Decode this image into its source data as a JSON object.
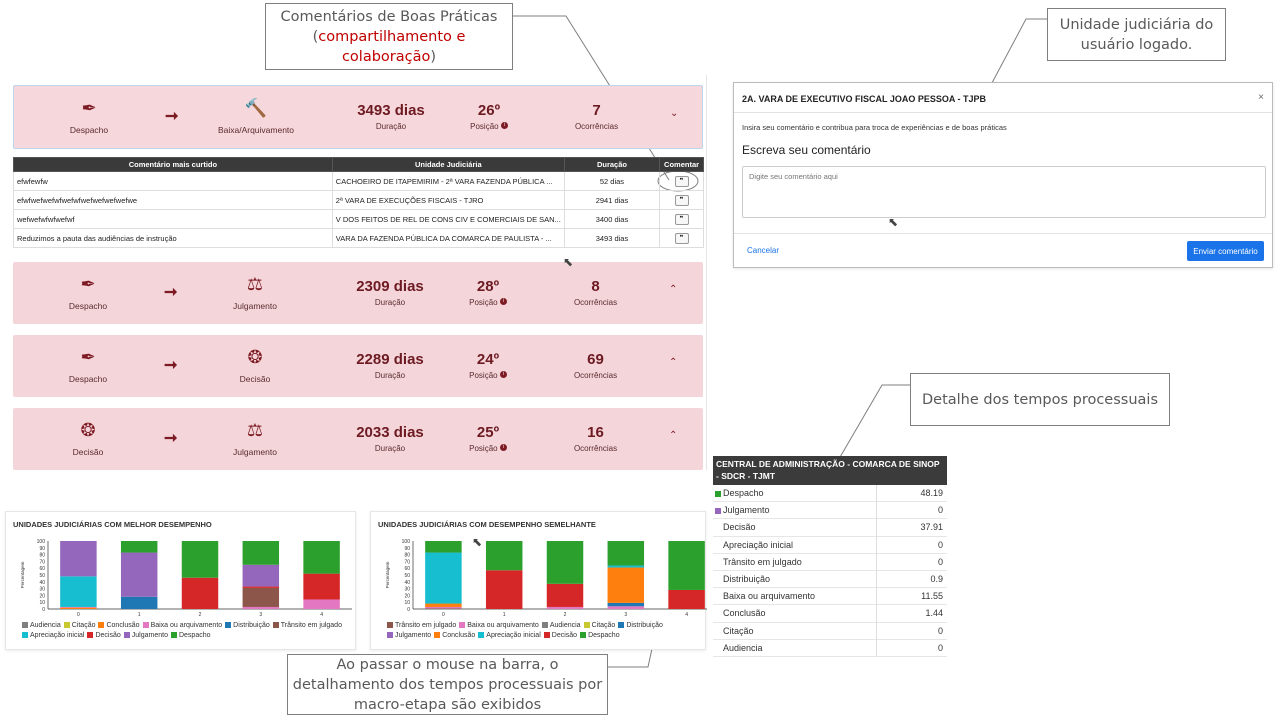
{
  "callouts": {
    "boas_praticas": {
      "line1": "Comentários de Boas Práticas",
      "line2_open": "(",
      "line2_red": "compartilhamento e",
      "line3_red": "colaboração",
      "line3_close": ")"
    },
    "unidade": {
      "line1": "Unidade judiciária do",
      "line2": "usuário logado."
    },
    "detalhe": {
      "text": "Detalhe dos tempos processuais"
    },
    "mouse": {
      "line1": "Ao passar o mouse na barra, o",
      "line2": "detalhamento dos tempos processuais por",
      "line3": "macro-etapa são exibidos"
    }
  },
  "flows": [
    {
      "from_icon": "gavel-pen-icon",
      "from": "Despacho",
      "to_icon": "hammer-icon",
      "to": "Baixa/Arquivamento",
      "duration": "3493 dias",
      "duration_label": "Duração",
      "position": "26º",
      "position_label": "Posição",
      "occurrences": "7",
      "occurrences_label": "Ocorrências",
      "chevron": "⌄"
    },
    {
      "from_icon": "pen-icon",
      "from": "Despacho",
      "to_icon": "scales-icon",
      "to": "Julgamento",
      "duration": "2309 dias",
      "duration_label": "Duração",
      "position": "28º",
      "position_label": "Posição",
      "occurrences": "8",
      "occurrences_label": "Ocorrências",
      "chevron": "⌃"
    },
    {
      "from_icon": "pen-icon",
      "from": "Despacho",
      "to_icon": "brain-icon",
      "to": "Decisão",
      "duration": "2289 dias",
      "duration_label": "Duração",
      "position": "24º",
      "position_label": "Posição",
      "occurrences": "69",
      "occurrences_label": "Ocorrências",
      "chevron": "⌃"
    },
    {
      "from_icon": "brain-icon",
      "from": "Decisão",
      "to_icon": "scales-icon",
      "to": "Julgamento",
      "duration": "2033 dias",
      "duration_label": "Duração",
      "position": "25º",
      "position_label": "Posição",
      "occurrences": "16",
      "occurrences_label": "Ocorrências",
      "chevron": "⌃"
    }
  ],
  "comments_table": {
    "headers": [
      "Comentário mais curtido",
      "Unidade Judiciária",
      "Duração",
      "Comentar"
    ],
    "rows": [
      [
        "efwfewfw",
        "CACHOEIRO DE ITAPEMIRIM - 2ª VARA FAZENDA PÚBLICA ...",
        "52 dias"
      ],
      [
        "efwfwefwefwfwefwfwefwefwefwefwe",
        "2ª VARA DE EXECUÇÕES FISCAIS - TJRO",
        "2941 dias"
      ],
      [
        "wefwefwfwfwefwf",
        "V DOS FEITOS DE REL DE CONS CIV E COMERCIAIS DE SAN...",
        "3400 dias"
      ],
      [
        "Reduzimos a pauta das audiências de instrução",
        "VARA DA FAZENDA PÚBLICA DA COMARCA DE PAULISTA - ...",
        "3493 dias"
      ]
    ]
  },
  "modal": {
    "title": "2A. VARA DE EXECUTIVO FISCAL JOAO PESSOA - TJPB",
    "close": "×",
    "hint": "Insira seu comentário e contribua para troca de experiências e de boas práticas",
    "heading": "Escreva seu comentário",
    "placeholder": "Digite seu comentário aqui",
    "cancel": "Cancelar",
    "send": "Enviar comentário"
  },
  "colors": {
    "Audiencia": "#7f7f7f",
    "Citação": "#c8c832",
    "Conclusão": "#ff7f0e",
    "Baixa ou arquivamento": "#e377c2",
    "Distribuição": "#1f77b4",
    "Trânsito em julgado": "#8c564b",
    "Apreciação inicial": "#17becf",
    "Decisão": "#d62728",
    "Julgamento": "#9467bd",
    "Despacho": "#2ca02c"
  },
  "chart_data": [
    {
      "type": "bar",
      "stacked": true,
      "title": "UNIDADES JUDICIÁRIAS COM MELHOR DESEMPENHO",
      "ylabel": "Percentagem",
      "ylim": [
        0,
        100
      ],
      "yticks": [
        0,
        10,
        20,
        30,
        40,
        50,
        60,
        70,
        80,
        90,
        100
      ],
      "categories": [
        "0",
        "1",
        "2",
        "3",
        "4"
      ],
      "series": [
        {
          "name": "Audiencia",
          "values": [
            0,
            0,
            0,
            0,
            0
          ]
        },
        {
          "name": "Citação",
          "values": [
            0,
            0,
            0,
            0,
            0
          ]
        },
        {
          "name": "Conclusão",
          "values": [
            2,
            0,
            0,
            0,
            0
          ]
        },
        {
          "name": "Baixa ou arquivamento",
          "values": [
            1,
            0,
            0,
            3,
            14
          ]
        },
        {
          "name": "Distribuição",
          "values": [
            0,
            18,
            0,
            0,
            0
          ]
        },
        {
          "name": "Trânsito em julgado",
          "values": [
            0,
            0,
            0,
            28,
            0
          ]
        },
        {
          "name": "Apreciação inicial",
          "values": [
            45,
            0,
            0,
            0,
            0
          ]
        },
        {
          "name": "Decisão",
          "values": [
            0,
            0,
            46,
            2,
            38
          ]
        },
        {
          "name": "Julgamento",
          "values": [
            52,
            65,
            0,
            32,
            0
          ]
        },
        {
          "name": "Despacho",
          "values": [
            0,
            17,
            54,
            35,
            48
          ]
        }
      ],
      "legend": [
        "Audiencia",
        "Citação",
        "Conclusão",
        "Baixa ou arquivamento",
        "Distribuição",
        "Trânsito em julgado",
        "Apreciação inicial",
        "Decisão",
        "Julgamento",
        "Despacho"
      ]
    },
    {
      "type": "bar",
      "stacked": true,
      "title": "UNIDADES JUDICIÁRIAS COM DESEMPENHO SEMELHANTE",
      "ylabel": "Percentagem",
      "ylim": [
        0,
        100
      ],
      "yticks": [
        0,
        10,
        20,
        30,
        40,
        50,
        60,
        70,
        80,
        90,
        100
      ],
      "categories": [
        "0",
        "1",
        "2",
        "3",
        "4"
      ],
      "series": [
        {
          "name": "Trânsito em julgado",
          "values": [
            1,
            0,
            0,
            0,
            0
          ]
        },
        {
          "name": "Baixa ou arquivamento",
          "values": [
            2,
            0,
            3,
            4,
            0
          ]
        },
        {
          "name": "Audiencia",
          "values": [
            0,
            0,
            0,
            0,
            0
          ]
        },
        {
          "name": "Citação",
          "values": [
            0,
            0,
            0,
            0,
            0
          ]
        },
        {
          "name": "Distribuição",
          "values": [
            0,
            0,
            0,
            5,
            0
          ]
        },
        {
          "name": "Conclusão",
          "values": [
            5,
            0,
            0,
            52,
            0
          ]
        },
        {
          "name": "Apreciação inicial",
          "values": [
            75,
            0,
            0,
            3,
            0
          ]
        },
        {
          "name": "Decisão",
          "values": [
            0,
            57,
            34,
            0,
            28
          ]
        },
        {
          "name": "Julgamento",
          "values": [
            0,
            0,
            0,
            0,
            0
          ]
        },
        {
          "name": "Despacho",
          "values": [
            17,
            43,
            63,
            36,
            72
          ]
        }
      ],
      "legend": [
        "Trânsito em julgado",
        "Baixa ou arquivamento",
        "Audiencia",
        "Citação",
        "Distribuição",
        "Julgamento",
        "Conclusão",
        "Apreciação inicial",
        "Decisão",
        "Despacho"
      ]
    },
    {
      "type": "table",
      "title": "CENTRAL DE ADMINISTRAÇÃO - COMARCA DE SINOP - SDCR - TJMT",
      "rows": [
        {
          "label": "Despacho",
          "value": "48.19"
        },
        {
          "label": "Julgamento",
          "value": "0"
        },
        {
          "label": "Decisão",
          "value": "37.91"
        },
        {
          "label": "Apreciação inicial",
          "value": "0"
        },
        {
          "label": "Trânsito em julgado",
          "value": "0"
        },
        {
          "label": "Distribuição",
          "value": "0.9"
        },
        {
          "label": "Baixa ou arquivamento",
          "value": "11.55"
        },
        {
          "label": "Conclusão",
          "value": "1.44"
        },
        {
          "label": "Citação",
          "value": "0"
        },
        {
          "label": "Audiencia",
          "value": "0"
        }
      ]
    }
  ]
}
